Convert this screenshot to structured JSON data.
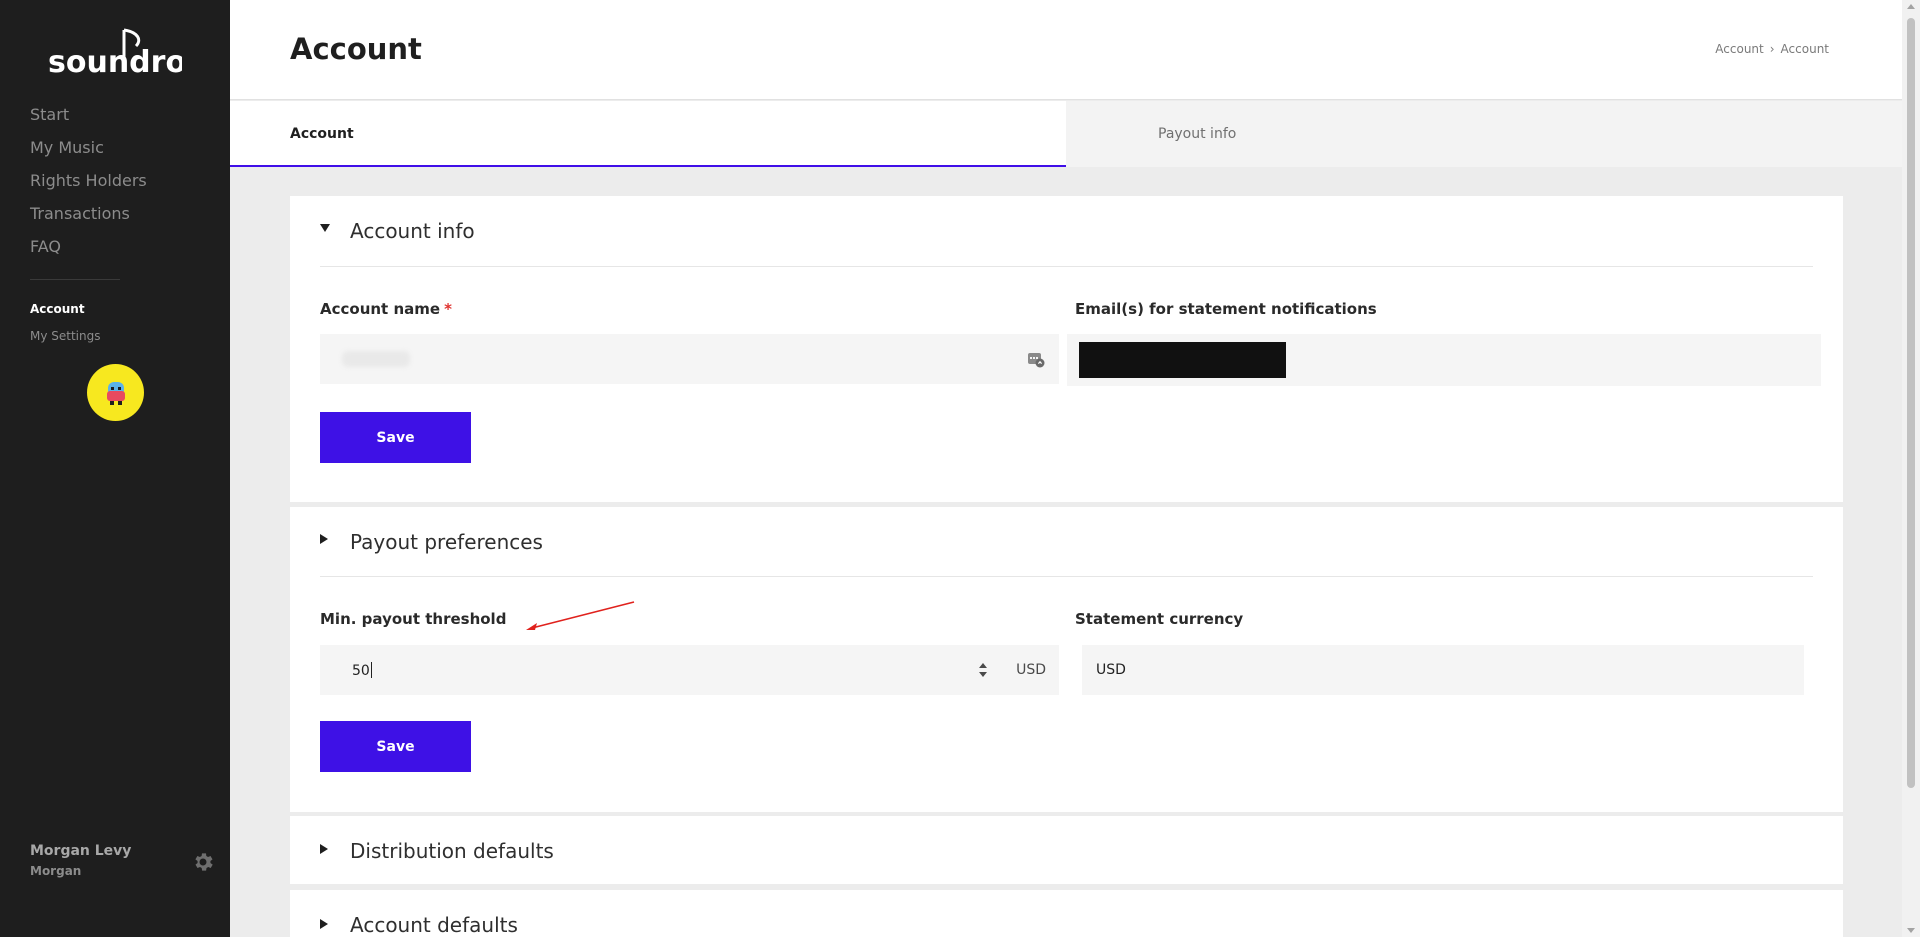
{
  "sidebar": {
    "logo_text": "soundrop",
    "nav": [
      "Start",
      "My Music",
      "Rights Holders",
      "Transactions",
      "FAQ"
    ],
    "section_active": "Account",
    "section_sub": "My Settings",
    "user_name": "Morgan Levy",
    "user_short": "Morgan",
    "avatar_color": "#f7e81f"
  },
  "header": {
    "title": "Account",
    "breadcrumb": [
      "Account",
      "Account"
    ],
    "breadcrumb_sep": "›"
  },
  "tabs": [
    {
      "label": "Account",
      "active": true
    },
    {
      "label": "Payout info",
      "active": false
    }
  ],
  "account_info": {
    "title": "Account info",
    "expanded": true,
    "account_name_label": "Account name",
    "required_mark": "*",
    "emails_label": "Email(s) for statement notifications",
    "save_label": "Save"
  },
  "payout_preferences": {
    "title": "Payout preferences",
    "expanded": false,
    "threshold_label": "Min. payout threshold",
    "threshold_value": "50",
    "threshold_unit": "USD",
    "currency_label": "Statement currency",
    "currency_value": "USD",
    "save_label": "Save"
  },
  "distribution_defaults": {
    "title": "Distribution defaults",
    "expanded": false
  },
  "account_defaults": {
    "title": "Account defaults",
    "expanded": false
  },
  "colors": {
    "accent": "#3e11e6",
    "sidebar_bg": "#1e1e1e",
    "annotation_arrow": "#e0221d"
  }
}
